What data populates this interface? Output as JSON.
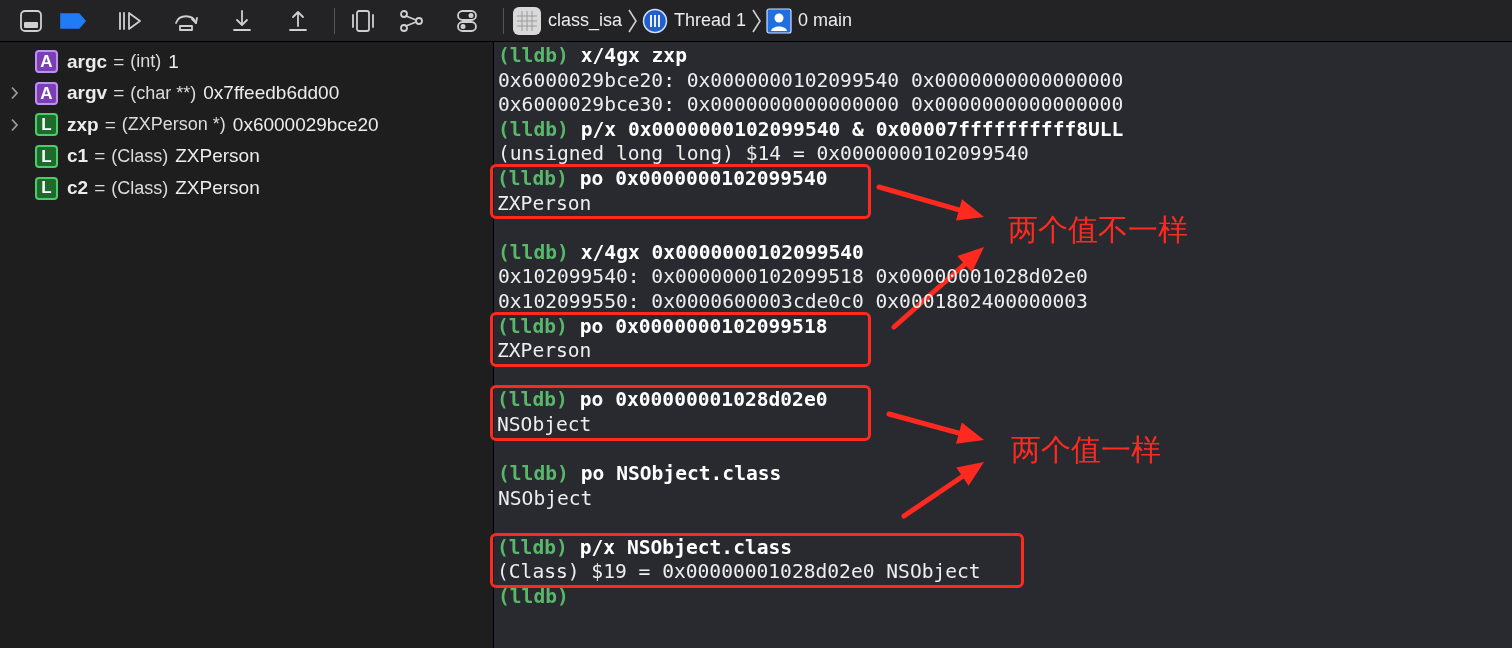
{
  "toolbar": {
    "breakpoints_active": true,
    "breadcrumb": [
      {
        "kind": "app",
        "label": "class_isa"
      },
      {
        "kind": "thread",
        "label": "Thread 1"
      },
      {
        "kind": "frame",
        "label": "0 main"
      }
    ]
  },
  "variables": [
    {
      "badge": "A",
      "kind": "argument",
      "has_children": false,
      "name": "argc",
      "equals": "=",
      "type": "(int)",
      "value": "1"
    },
    {
      "badge": "A",
      "kind": "argument",
      "has_children": true,
      "name": "argv",
      "equals": "=",
      "type": "(char **)",
      "value": "0x7ffeedb6dd00"
    },
    {
      "badge": "L",
      "kind": "local",
      "has_children": true,
      "name": "zxp",
      "equals": "=",
      "type": "(ZXPerson *)",
      "value": "0x6000029bce20"
    },
    {
      "badge": "L",
      "kind": "local",
      "has_children": false,
      "name": "c1",
      "equals": "=",
      "type": "(Class)",
      "value": "ZXPerson"
    },
    {
      "badge": "L",
      "kind": "local",
      "has_children": false,
      "name": "c2",
      "equals": "=",
      "type": "(Class)",
      "value": "ZXPerson"
    }
  ],
  "console": {
    "blocks": [
      {
        "kind": "plain",
        "lines": [
          {
            "kind": "command",
            "prompt": "(lldb)",
            "text": "x/4gx zxp"
          },
          {
            "kind": "output",
            "text": "0x6000029bce20: 0x0000000102099540 0x0000000000000000"
          },
          {
            "kind": "output",
            "text": "0x6000029bce30: 0x0000000000000000 0x0000000000000000"
          },
          {
            "kind": "command",
            "prompt": "(lldb)",
            "text": "p/x 0x0000000102099540 & 0x00007ffffffffff8ULL"
          },
          {
            "kind": "output",
            "text": "(unsigned long long) $14 = 0x0000000102099540"
          }
        ]
      },
      {
        "kind": "boxed",
        "lines": [
          {
            "kind": "command",
            "prompt": "(lldb)",
            "text": "po 0x0000000102099540"
          },
          {
            "kind": "output",
            "text": "ZXPerson"
          }
        ]
      },
      {
        "kind": "blank"
      },
      {
        "kind": "plain",
        "lines": [
          {
            "kind": "command",
            "prompt": "(lldb)",
            "text": "x/4gx 0x0000000102099540"
          },
          {
            "kind": "output",
            "text": "0x102099540: 0x0000000102099518 0x00000001028d02e0"
          },
          {
            "kind": "output",
            "text": "0x102099550: 0x0000600003cde0c0 0x0001802400000003"
          }
        ]
      },
      {
        "kind": "boxed",
        "lines": [
          {
            "kind": "command",
            "prompt": "(lldb)",
            "text": "po 0x0000000102099518"
          },
          {
            "kind": "output",
            "text": "ZXPerson"
          }
        ]
      },
      {
        "kind": "blank"
      },
      {
        "kind": "boxed",
        "lines": [
          {
            "kind": "command",
            "prompt": "(lldb)",
            "text": "po 0x00000001028d02e0"
          },
          {
            "kind": "output",
            "text": "NSObject"
          }
        ]
      },
      {
        "kind": "blank"
      },
      {
        "kind": "plain",
        "lines": [
          {
            "kind": "command",
            "prompt": "(lldb)",
            "text": "po NSObject.class"
          },
          {
            "kind": "output",
            "text": "NSObject"
          }
        ]
      },
      {
        "kind": "blank"
      },
      {
        "kind": "boxed",
        "lines": [
          {
            "kind": "command",
            "prompt": "(lldb)",
            "text": "p/x NSObject.class"
          },
          {
            "kind": "output",
            "text": "(Class) $19 = 0x00000001028d02e0 NSObject"
          }
        ]
      },
      {
        "kind": "plain",
        "lines": [
          {
            "kind": "prompt",
            "prompt": "(lldb)"
          }
        ]
      }
    ]
  },
  "annotations": [
    {
      "text": "两个值不一样"
    },
    {
      "text": "两个值一样"
    }
  ]
}
